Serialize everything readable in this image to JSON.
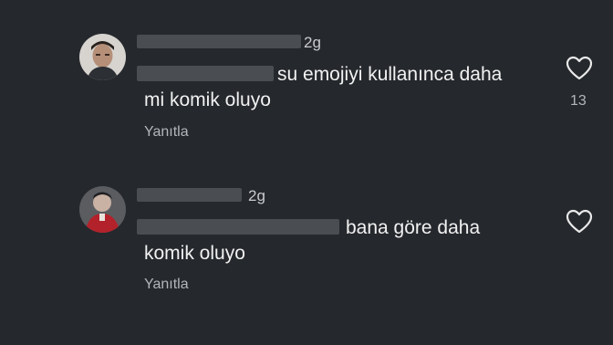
{
  "comments": [
    {
      "time": "2g",
      "text_line1": "su emojiyi kullanınca daha",
      "text_line2": "mi komik oluyo",
      "reply_label": "Yanıtla",
      "like_count": "13",
      "like_icon": "heart-outline-icon"
    },
    {
      "time": "2g",
      "text_line1": "bana göre daha",
      "text_line2": "komik oluyo",
      "reply_label": "Yanıtla",
      "like_icon": "heart-outline-icon"
    }
  ],
  "colors": {
    "background": "#25282d",
    "text": "#f1f1f1",
    "muted": "#b3b6ba"
  }
}
